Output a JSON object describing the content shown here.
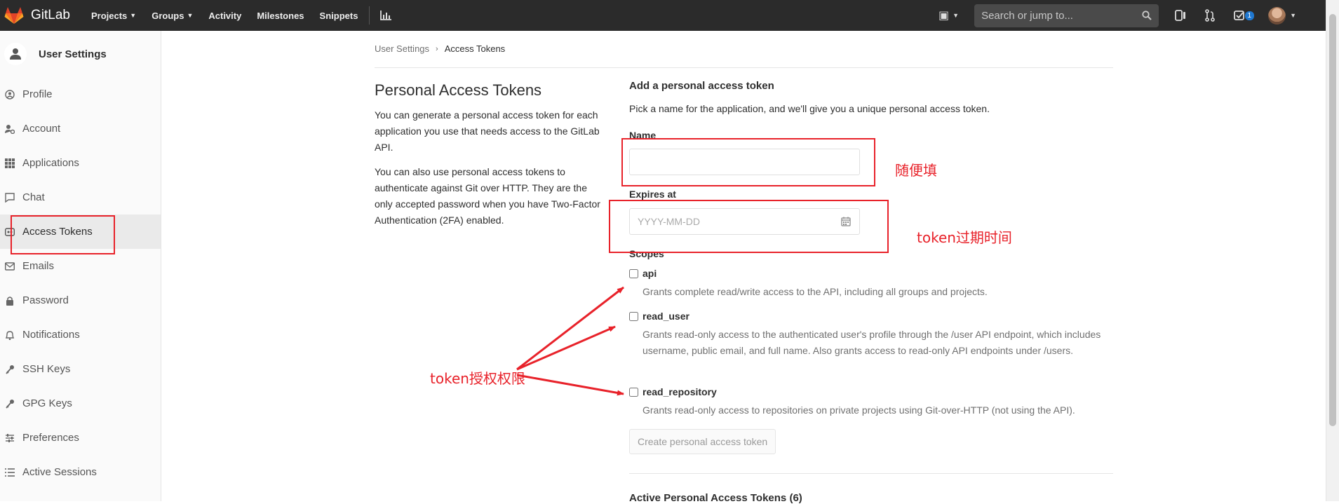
{
  "navbar": {
    "brand": "GitLab",
    "links": [
      {
        "label": "Projects",
        "dropdown": true
      },
      {
        "label": "Groups",
        "dropdown": true
      },
      {
        "label": "Activity",
        "dropdown": false
      },
      {
        "label": "Milestones",
        "dropdown": false
      },
      {
        "label": "Snippets",
        "dropdown": false
      }
    ],
    "search_placeholder": "Search or jump to...",
    "todo_count": "1",
    "colors": {
      "bar": "#2b2b2b",
      "badge": "#1f78d1"
    }
  },
  "sidebar": {
    "title": "User Settings",
    "items": [
      {
        "label": "Profile",
        "icon": "profile-icon"
      },
      {
        "label": "Account",
        "icon": "account-icon"
      },
      {
        "label": "Applications",
        "icon": "applications-icon"
      },
      {
        "label": "Chat",
        "icon": "chat-icon"
      },
      {
        "label": "Access Tokens",
        "icon": "access-tokens-icon",
        "active": true
      },
      {
        "label": "Emails",
        "icon": "emails-icon"
      },
      {
        "label": "Password",
        "icon": "lock-icon"
      },
      {
        "label": "Notifications",
        "icon": "bell-icon"
      },
      {
        "label": "SSH Keys",
        "icon": "key-icon"
      },
      {
        "label": "GPG Keys",
        "icon": "key-icon"
      },
      {
        "label": "Preferences",
        "icon": "sliders-icon"
      },
      {
        "label": "Active Sessions",
        "icon": "sessions-icon"
      }
    ]
  },
  "breadcrumb": {
    "parent": "User Settings",
    "current": "Access Tokens"
  },
  "intro": {
    "heading": "Personal Access Tokens",
    "paragraph_1": "You can generate a personal access token for each application you use that needs access to the GitLab API.",
    "paragraph_2": "You can also use personal access tokens to authenticate against Git over HTTP. They are the only accepted password when you have Two-Factor Authentication (2FA) enabled."
  },
  "form": {
    "title": "Add a personal access token",
    "description": "Pick a name for the application, and we'll give you a unique personal access token.",
    "name_label": "Name",
    "name_value": "",
    "expires_label": "Expires at",
    "expires_placeholder": "YYYY-MM-DD",
    "scopes_label": "Scopes",
    "scopes": [
      {
        "name": "api",
        "checked": false,
        "description": "Grants complete read/write access to the API, including all groups and projects."
      },
      {
        "name": "read_user",
        "checked": false,
        "description": "Grants read-only access to the authenticated user's profile through the /user API endpoint, which includes username, public email, and full name. Also grants access to read-only API endpoints under /users."
      },
      {
        "name": "read_repository",
        "checked": false,
        "description": "Grants read-only access to repositories on private projects using Git-over-HTTP (not using the API)."
      }
    ],
    "submit_label": "Create personal access token",
    "active_tokens_title": "Active Personal Access Tokens (6)"
  },
  "annotations": {
    "name_note": "随便填",
    "expiry_note": "token过期时间",
    "scopes_note": "token授权权限",
    "color": "#e8222a"
  }
}
